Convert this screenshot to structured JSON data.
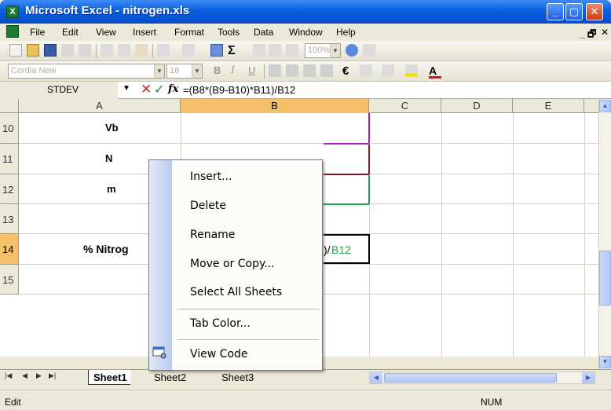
{
  "window": {
    "title": "Microsoft Excel - nitrogen.xls"
  },
  "menubar": {
    "items": [
      "File",
      "Edit",
      "View",
      "Insert",
      "Format",
      "Tools",
      "Data",
      "Window",
      "Help"
    ]
  },
  "toolbar": {
    "zoom": "100%",
    "font": "Cordia New",
    "size": "16"
  },
  "formula_bar": {
    "name_box": "STDEV",
    "formula": "=(B8*(B9-B10)*B11)/B12"
  },
  "columns": [
    "A",
    "B",
    "C",
    "D",
    "E"
  ],
  "rows": [
    "10",
    "11",
    "12",
    "13",
    "14",
    "15"
  ],
  "cells": {
    "a10": "Vb",
    "a11": "N",
    "a12": "m",
    "a14": "% Nitrog",
    "b14_partial": ")/",
    "b14_ref": "B12"
  },
  "context_menu": {
    "items": [
      "Insert...",
      "Delete",
      "Rename",
      "Move or Copy...",
      "Select All Sheets",
      "Tab Color...",
      "View Code"
    ],
    "icons": [
      "view-code-icon"
    ]
  },
  "sheets": [
    "Sheet1",
    "Sheet2",
    "Sheet3"
  ],
  "status": {
    "mode": "Edit",
    "num": "NUM"
  },
  "colors": {
    "titlebar": "#0a5fdd",
    "selected_header": "#f5c06a",
    "ref_green": "#1fa44a",
    "ref_purple": "#a020c0",
    "ref_darkred": "#8b1a1a"
  }
}
